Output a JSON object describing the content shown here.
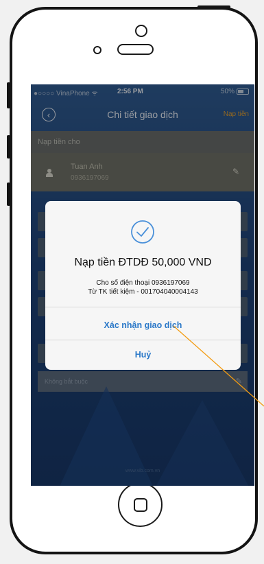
{
  "status_bar": {
    "carrier": "●○○○○ VinaPhone ᯤ",
    "time": "2:56 PM",
    "battery": "50%"
  },
  "nav": {
    "title": "Chi tiết giao dịch",
    "action": "Nạp tiền"
  },
  "form": {
    "section_label": "Nạp tiền cho",
    "recipient_name": "Tuan Anh",
    "recipient_phone": "0936197069",
    "optional_placeholder": "Không bắt buộc",
    "footer": "www.vib.com.vn"
  },
  "dialog": {
    "title": "Nạp tiền ĐTDĐ 50,000 VND",
    "line1": "Cho số điện thoại 0936197069",
    "line2": "Từ TK tiết kiệm - 001704040004143",
    "confirm": "Xác nhận giao dịch",
    "cancel": "Huỷ"
  },
  "colors": {
    "dialog_button": "#2a78c8",
    "nav_action": "#f5a623",
    "callout_line": "#f39c12"
  },
  "icons": [
    "back-icon",
    "user-icon",
    "edit-icon",
    "check-circle-icon",
    "battery-icon",
    "home-square-icon"
  ]
}
